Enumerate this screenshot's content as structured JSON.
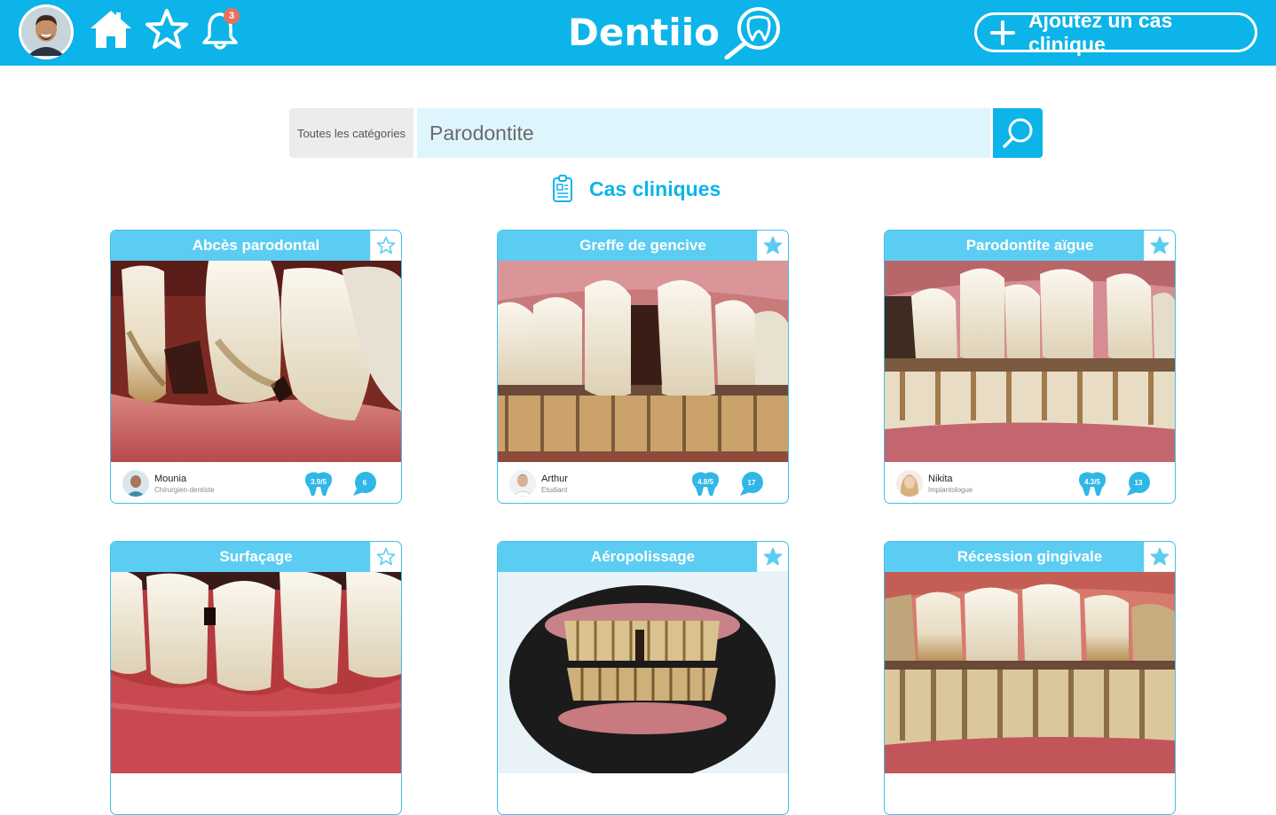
{
  "header": {
    "logo_text": "Dentiio",
    "notification_count": "3",
    "add_case_label": "Ajoutez un cas clinique",
    "brand_color": "#0cb4e9"
  },
  "search": {
    "category_label": "Toutes les catégories",
    "query": "Parodontite"
  },
  "section": {
    "title": "Cas cliniques"
  },
  "cards": [
    {
      "title": "Abcès parodontal",
      "favorited": false,
      "author": "Mounia",
      "role": "Chirurgien-dentiste",
      "rating": "3.9/5",
      "comments": "6"
    },
    {
      "title": "Greffe de gencive",
      "favorited": true,
      "author": "Arthur",
      "role": "Etudiant",
      "rating": "4.8/5",
      "comments": "17"
    },
    {
      "title": "Parodontite aïgue",
      "favorited": true,
      "author": "Nikita",
      "role": "Implantologue",
      "rating": "4.3/5",
      "comments": "13"
    },
    {
      "title": "Surfaçage",
      "favorited": false
    },
    {
      "title": "Aéropolissage",
      "favorited": true
    },
    {
      "title": "Récession gingivale",
      "favorited": true
    }
  ]
}
